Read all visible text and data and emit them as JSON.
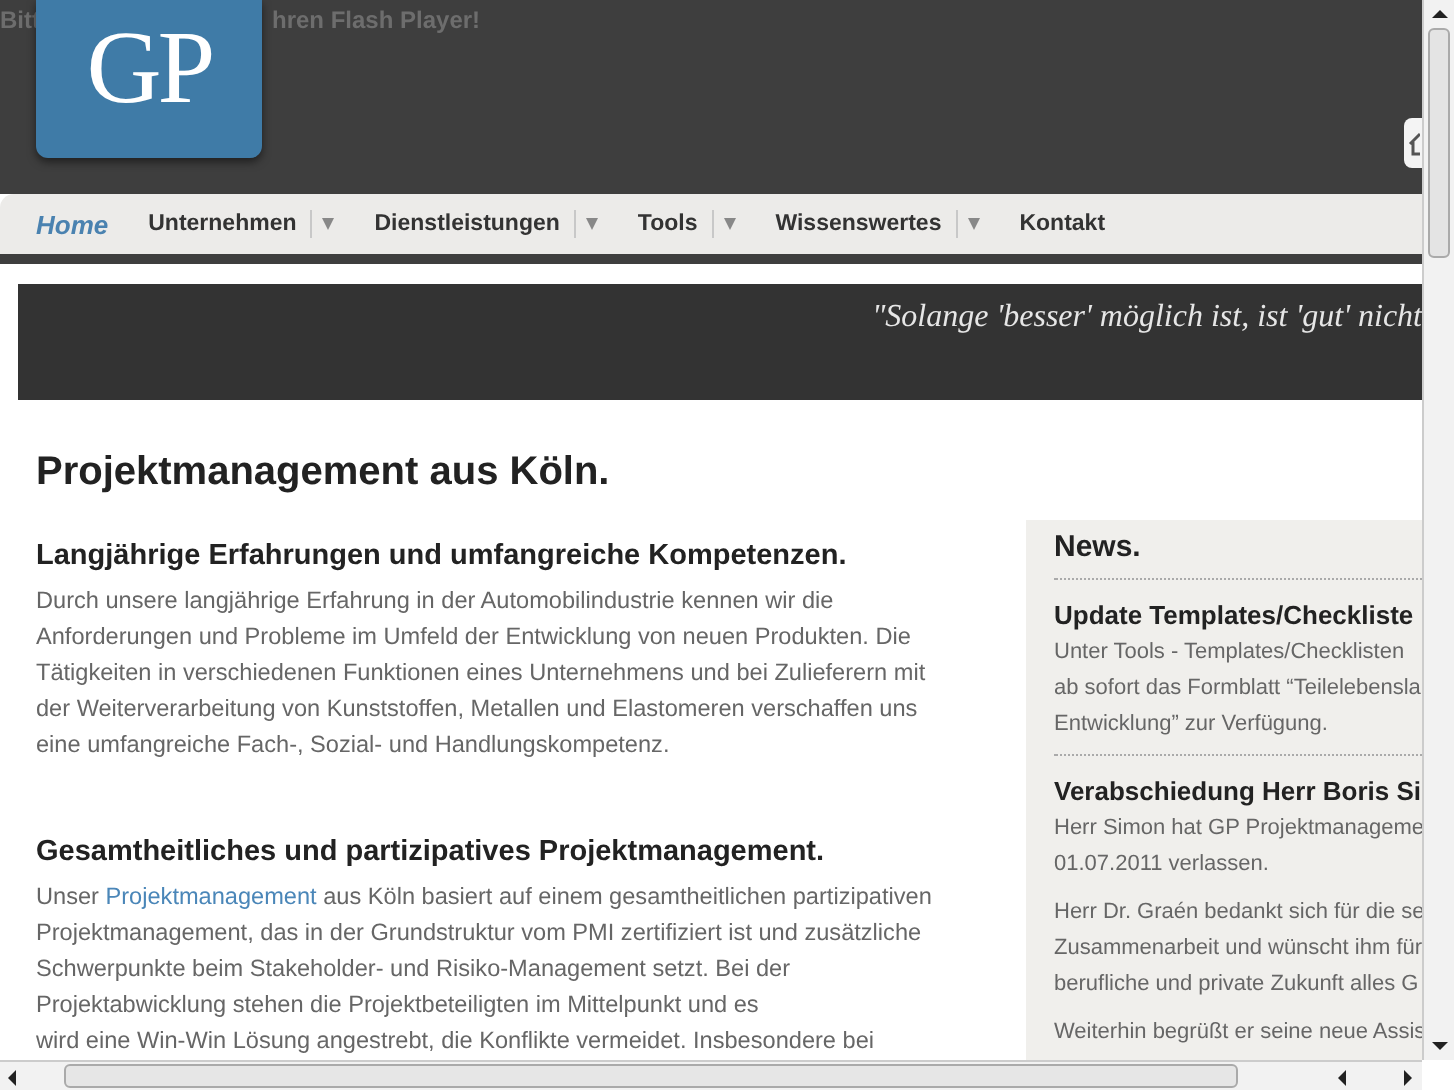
{
  "header": {
    "flash_notice_parts": [
      "Bitt",
      "hren Flash Player!"
    ],
    "logo": "GP"
  },
  "nav": [
    {
      "label": "Home",
      "selected": true,
      "dropdown": false
    },
    {
      "label": "Unternehmen",
      "selected": false,
      "dropdown": true
    },
    {
      "label": "Dienstleistungen",
      "selected": false,
      "dropdown": true
    },
    {
      "label": "Tools",
      "selected": false,
      "dropdown": true
    },
    {
      "label": "Wissenswertes",
      "selected": false,
      "dropdown": true
    },
    {
      "label": "Kontakt",
      "selected": false,
      "dropdown": false
    }
  ],
  "quote": "\"Solange 'besser' möglich ist, ist 'gut' nicht",
  "title": "Projektmanagement aus Köln.",
  "sections": [
    {
      "heading": "Langjährige Erfahrungen und umfangreiche Kompetenzen.",
      "lines": [
        "Durch unsere langjährige Erfahrung in der Automobilindustrie kennen wir die",
        "Anforderungen und Probleme im Umfeld der Entwicklung von neuen Produkten. Die",
        "Tätigkeiten in verschiedenen Funktionen eines Unternehmens und bei Zulieferern mit",
        "der Weiterverarbeitung von Kunststoffen, Metallen und Elastomeren verschaffen uns",
        "eine umfangreiche Fach-, Sozial- und Handlungskompetenz."
      ]
    },
    {
      "heading": "Gesamtheitliches und partizipatives Projektmanagement.",
      "link": {
        "before": "Unser",
        "text": "Projektmanagement",
        "after": "aus Köln basiert auf einem gesamtheitlichen partizipativen"
      },
      "lines": [
        "Projektmanagement, das in der Grundstruktur vom PMI zertifiziert ist und zusätzliche",
        "Schwerpunkte beim Stakeholder- und Risiko-Management setzt. Bei der",
        "Projektabwicklung stehen die Projektbeteiligten im Mittelpunkt und es",
        "wird eine Win-Win Lösung angestrebt, die Konflikte vermeidet. Insbesondere bei"
      ]
    }
  ],
  "news": {
    "title": "News.",
    "items": [
      {
        "title": "Update Templates/Checkliste",
        "paragraphs": [
          [
            "Unter Tools - Templates/Checklisten",
            "ab sofort das Formblatt “Teilelebensla",
            "Entwicklung” zur Verfügung."
          ]
        ]
      },
      {
        "title": "Verabschiedung Herr Boris Si",
        "paragraphs": [
          [
            "Herr Simon hat GP Projektmanageme",
            "01.07.2011 verlassen."
          ],
          [
            "Herr Dr. Graén bedankt sich für die se",
            "Zusammenarbeit und wünscht ihm für",
            "berufliche und private Zukunft alles G"
          ],
          [
            "Weiterhin begrüßt er seine neue Assis"
          ]
        ]
      }
    ]
  }
}
